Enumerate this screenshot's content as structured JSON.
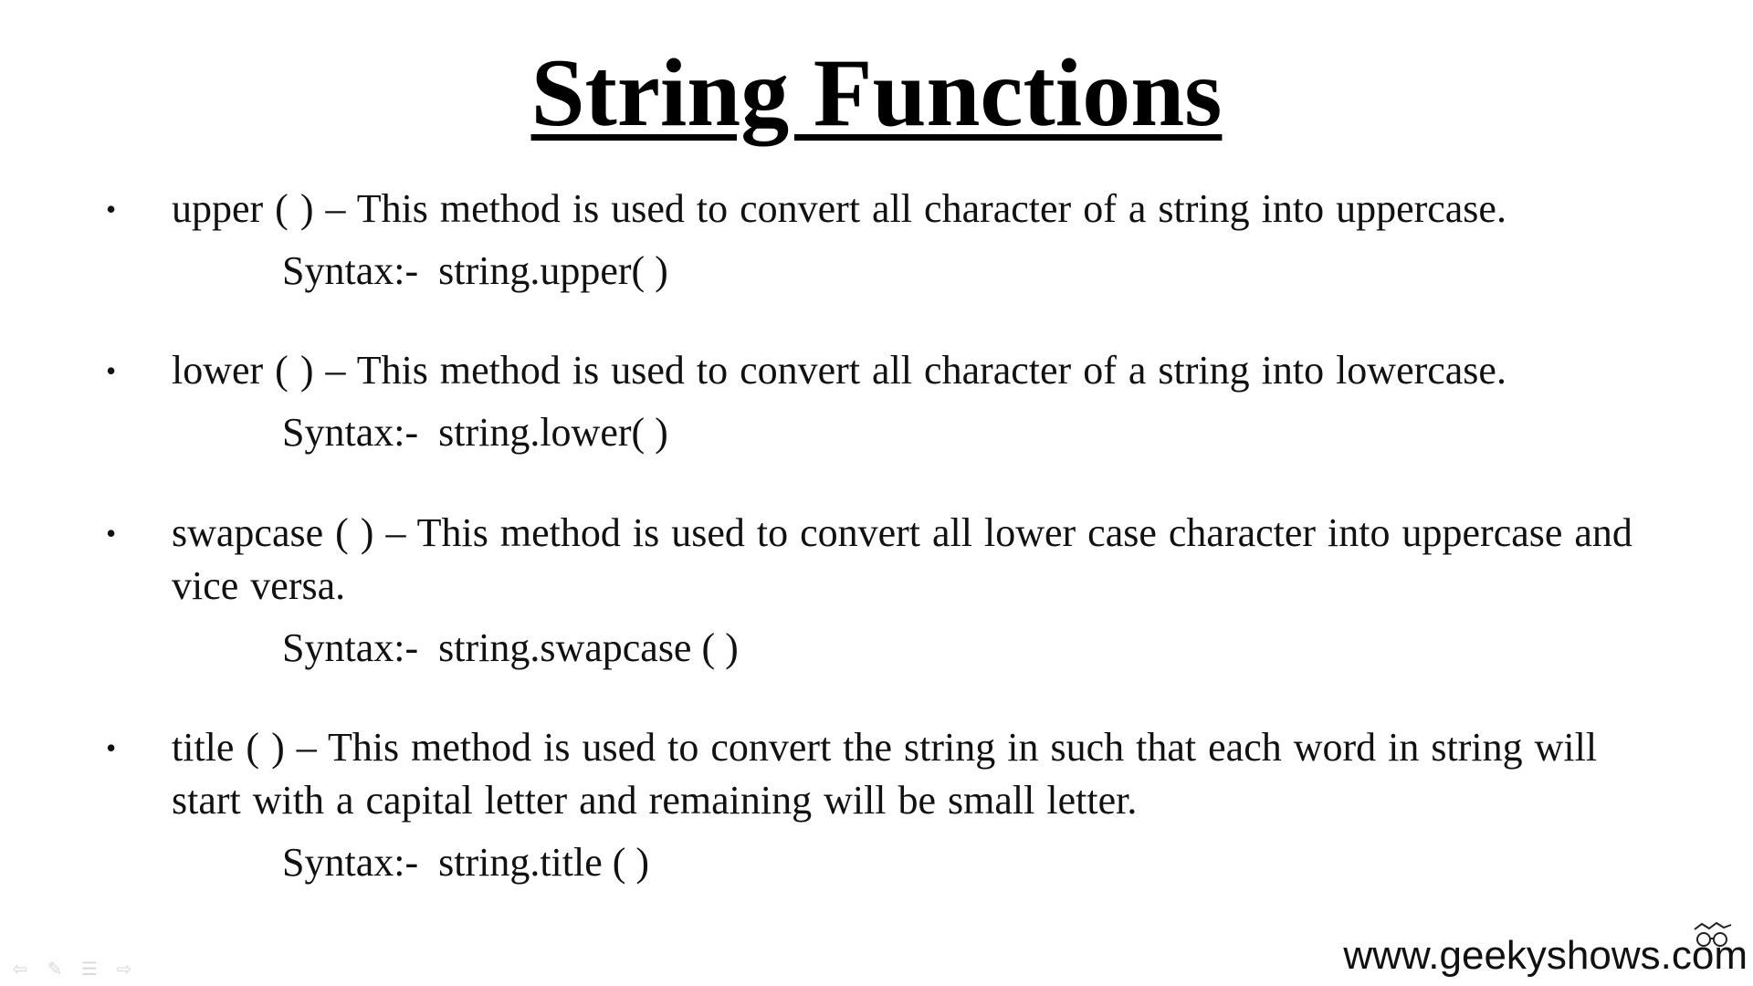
{
  "title": "String Functions",
  "items": [
    {
      "bullet": "•",
      "description": "upper ( ) – This method is used to convert all character of a string into uppercase.",
      "syntax": "Syntax:-  string.upper( )"
    },
    {
      "bullet": "•",
      "description": "lower ( ) – This method is used to convert all character of a string into lowercase.",
      "syntax": "Syntax:-  string.lower( )"
    },
    {
      "bullet": "•",
      "description": "swapcase ( ) – This method is used to convert all lower case character into uppercase and vice versa.",
      "syntax": "Syntax:-  string.swapcase ( )"
    },
    {
      "bullet": "•",
      "description": "title ( ) – This method is used to convert the string in such that each word in string will start with a capital letter and remaining will be small letter.",
      "syntax": "Syntax:-  string.title ( )"
    }
  ],
  "footer": {
    "url": "www.geekyshows.com",
    "logo_icon": "glasses-logo-icon"
  },
  "nav": {
    "prev_icon": "arrow-left-icon",
    "pen_icon": "pen-icon",
    "menu_icon": "menu-icon",
    "next_icon": "arrow-right-icon"
  }
}
